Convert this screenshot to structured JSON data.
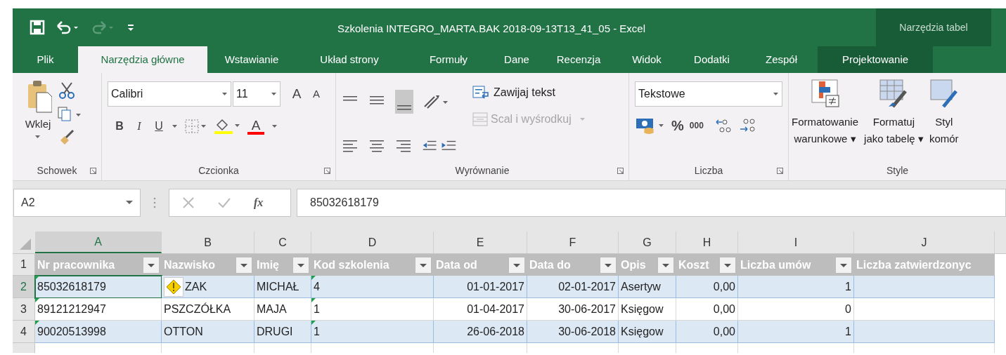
{
  "window": {
    "title": "Szkolenia INTEGRO_MARTA.BAK 2018-09-13T13_41_05 - Excel",
    "context_group": "Narzędzia tabel"
  },
  "tabs": [
    {
      "label": "Plik",
      "selected": false,
      "kind": "normal"
    },
    {
      "label": "Narzędzia główne",
      "selected": true,
      "kind": "normal"
    },
    {
      "label": "Wstawianie",
      "selected": false,
      "kind": "normal"
    },
    {
      "label": "Układ strony",
      "selected": false,
      "kind": "normal"
    },
    {
      "label": "Formuły",
      "selected": false,
      "kind": "normal"
    },
    {
      "label": "Dane",
      "selected": false,
      "kind": "normal"
    },
    {
      "label": "Recenzja",
      "selected": false,
      "kind": "normal"
    },
    {
      "label": "Widok",
      "selected": false,
      "kind": "normal"
    },
    {
      "label": "Dodatki",
      "selected": false,
      "kind": "normal"
    },
    {
      "label": "Zespół",
      "selected": false,
      "kind": "normal"
    },
    {
      "label": "Projektowanie",
      "selected": false,
      "kind": "contextual"
    }
  ],
  "ribbon": {
    "clipboard": {
      "paste": "Wklej",
      "group": "Schowek"
    },
    "font": {
      "name": "Calibri",
      "size": "11",
      "grow": "A",
      "shrink": "A",
      "bold": "B",
      "italic": "I",
      "underline": "U",
      "text_color_button": "A",
      "group": "Czcionka"
    },
    "alignment": {
      "wrap": "Zawijaj tekst",
      "merge": "Scal i wyśrodkuj",
      "merge_disabled": true,
      "group": "Wyrównanie"
    },
    "number": {
      "format": "Tekstowe",
      "percent": "%",
      "thousands": "000",
      "group": "Liczba"
    },
    "styles": {
      "buttons": [
        {
          "line1": "Formatowanie",
          "line2": "warunkowe ▾"
        },
        {
          "line1": "Formatuj",
          "line2": "jako tabelę ▾"
        },
        {
          "line1": "Styl",
          "line2": "komór"
        }
      ],
      "group": "Style"
    }
  },
  "formula_bar": {
    "name_box": "A2",
    "fx": "fx",
    "value": "85032618179"
  },
  "columns": [
    {
      "letter": "A",
      "header": "Nr pracownika",
      "kind": "text",
      "flagged": true,
      "selected": true
    },
    {
      "letter": "B",
      "header": "Nazwisko",
      "kind": "text",
      "flagged": false,
      "selected": false
    },
    {
      "letter": "C",
      "header": "Imię",
      "kind": "text",
      "flagged": false,
      "selected": false
    },
    {
      "letter": "D",
      "header": "Kod szkolenia",
      "kind": "text",
      "flagged": true,
      "selected": false
    },
    {
      "letter": "E",
      "header": "Data od",
      "kind": "number",
      "flagged": false,
      "selected": false
    },
    {
      "letter": "F",
      "header": "Data do",
      "kind": "number",
      "flagged": false,
      "selected": false
    },
    {
      "letter": "G",
      "header": "Opis",
      "kind": "text",
      "flagged": false,
      "selected": false
    },
    {
      "letter": "H",
      "header": "Koszt",
      "kind": "number",
      "flagged": false,
      "selected": false
    },
    {
      "letter": "I",
      "header": "Liczba umów",
      "kind": "number",
      "flagged": false,
      "selected": false
    },
    {
      "letter": "J",
      "header": "Liczba zatwierdzonyc",
      "kind": "text",
      "flagged": false,
      "selected": false
    }
  ],
  "header_row": "1",
  "rows": [
    {
      "number": "2",
      "selected": true,
      "banded": true,
      "warning": true,
      "cells": [
        "85032618179",
        "ZAK",
        "MICHAŁ",
        "4",
        "01-01-2017",
        "02-01-2017",
        "Asertyw",
        "0,00",
        "1",
        ""
      ]
    },
    {
      "number": "3",
      "selected": false,
      "banded": false,
      "warning": false,
      "cells": [
        "89121212947",
        "PSZCZÓŁKA",
        "MAJA",
        "1",
        "01-04-2017",
        "30-06-2017",
        "Księgow",
        "0,00",
        "0",
        ""
      ]
    },
    {
      "number": "4",
      "selected": false,
      "banded": true,
      "warning": false,
      "cells": [
        "90020513998",
        "OTTON",
        "DRUGI",
        "1",
        "26-06-2018",
        "30-06-2018",
        "Księgow",
        "0,00",
        "1",
        ""
      ]
    }
  ],
  "next_row_visible": true
}
